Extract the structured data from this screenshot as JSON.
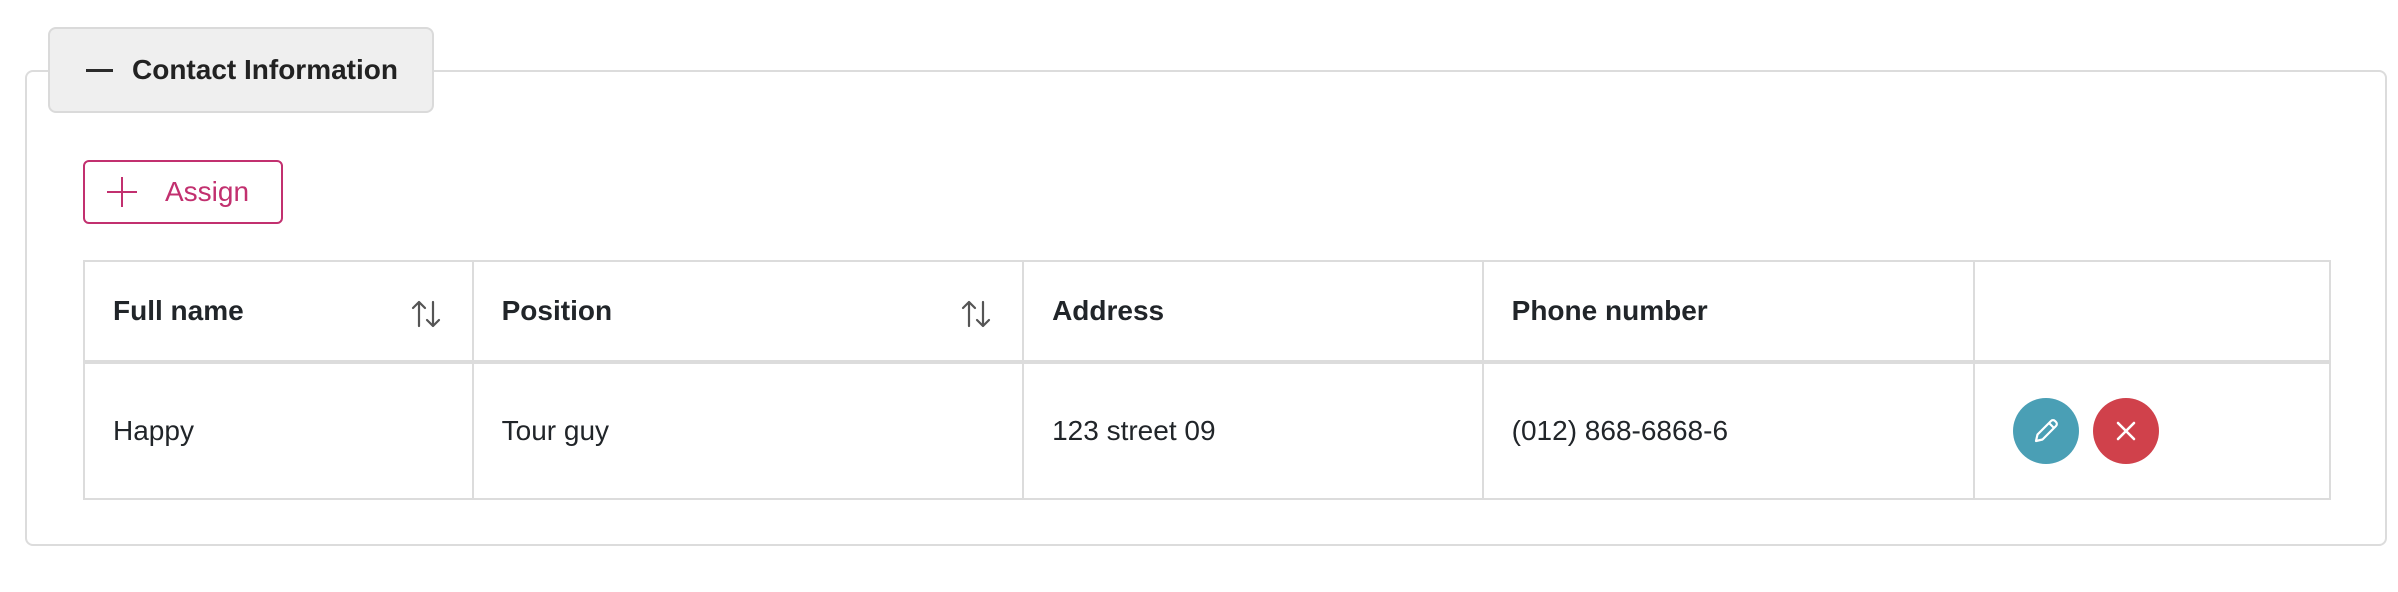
{
  "section": {
    "title": "Contact Information",
    "collapse_icon": "minus-icon"
  },
  "toolbar": {
    "assign_label": "Assign",
    "assign_icon": "plus-icon"
  },
  "table": {
    "columns": [
      {
        "label": "Full name",
        "sortable": true
      },
      {
        "label": "Position",
        "sortable": true
      },
      {
        "label": "Address",
        "sortable": false
      },
      {
        "label": "Phone number",
        "sortable": false
      },
      {
        "label": "",
        "sortable": false
      }
    ],
    "rows": [
      {
        "full_name": "Happy",
        "position": "Tour guy",
        "address": "123 street 09",
        "phone": "(012) 868-6868-6",
        "actions": [
          "edit-icon",
          "delete-icon"
        ]
      }
    ]
  },
  "colors": {
    "accent": "#c2306f",
    "edit": "#4a9fb5",
    "delete": "#d0414b",
    "border": "#dcdcdc"
  }
}
